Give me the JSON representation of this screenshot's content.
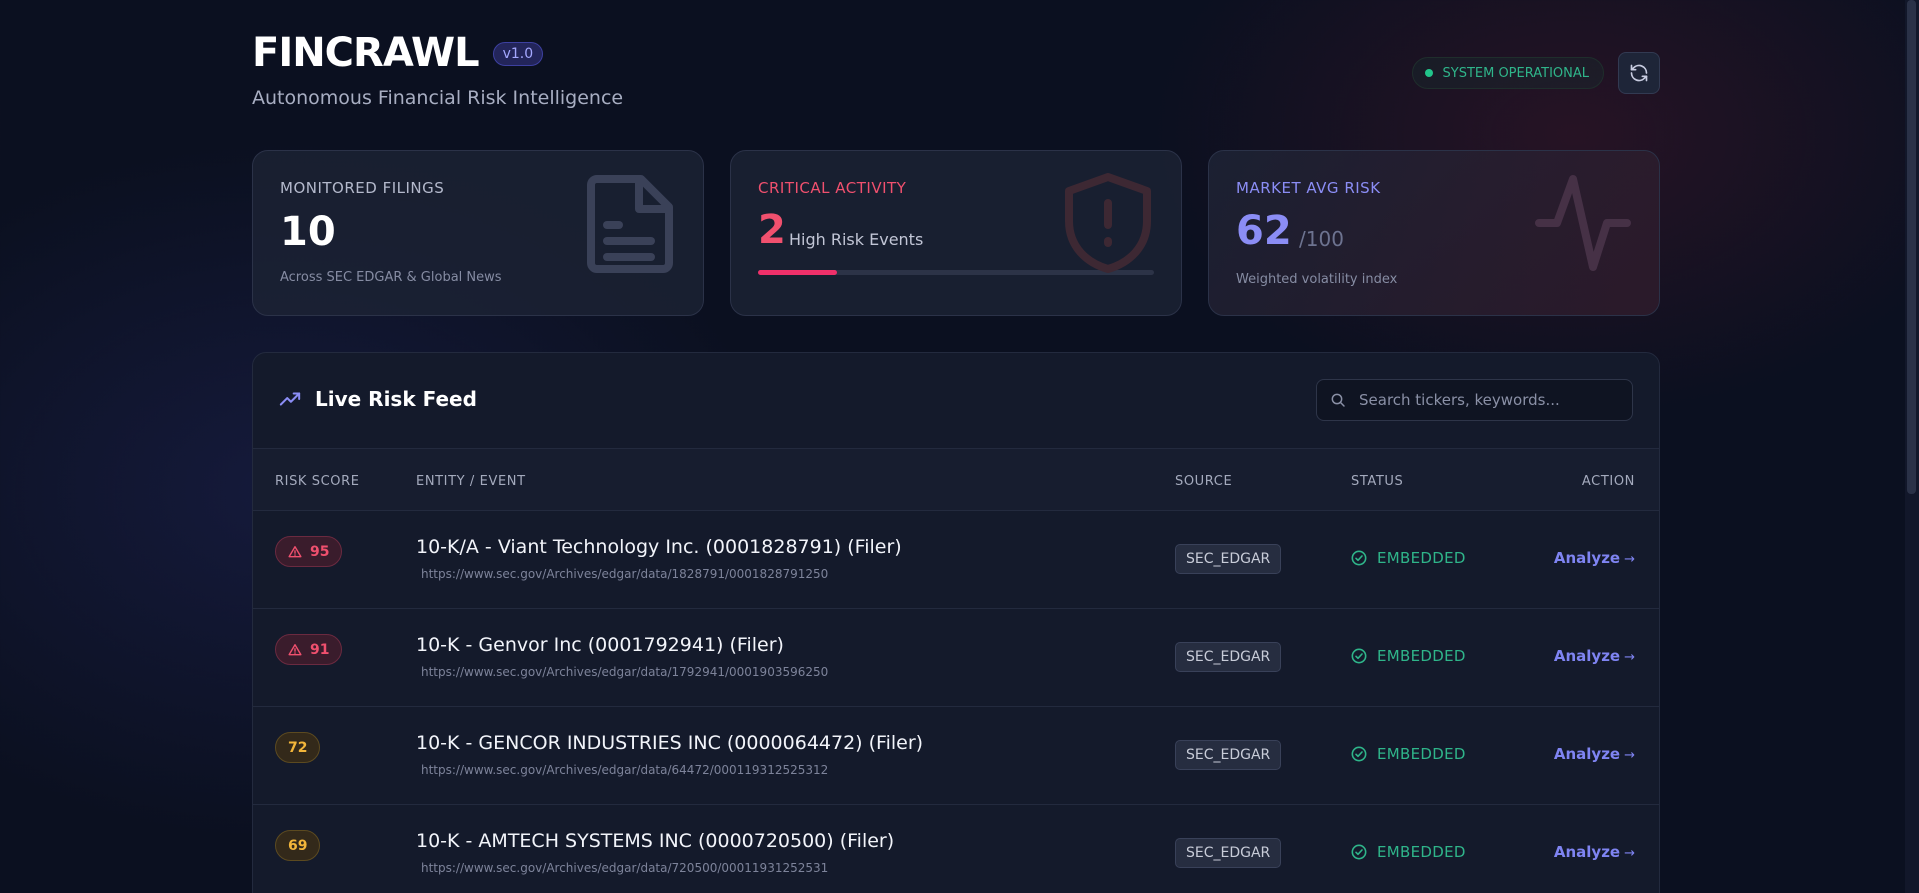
{
  "header": {
    "title": "FINCRAWL",
    "version": "v1.0",
    "subtitle": "Autonomous Financial Risk Intelligence",
    "status": "SYSTEM OPERATIONAL",
    "refresh_icon": "refresh-icon"
  },
  "stats": {
    "filings": {
      "label": "MONITORED FILINGS",
      "value": "10",
      "note": "Across SEC EDGAR & Global News",
      "icon": "document-icon"
    },
    "critical": {
      "label": "CRITICAL ACTIVITY",
      "value": "2",
      "suffix": "High Risk Events",
      "progress": 0.2,
      "icon": "shield-alert-icon"
    },
    "risk": {
      "label": "MARKET AVG RISK",
      "value": "62",
      "suffix": "/100",
      "note": "Weighted volatility index",
      "icon": "activity-icon"
    }
  },
  "feed": {
    "title": "Live Risk Feed",
    "icon": "trending-up-icon",
    "search_placeholder": "Search tickers, keywords...",
    "columns": {
      "score": "RISK SCORE",
      "entity": "ENTITY / EVENT",
      "source": "SOURCE",
      "status": "STATUS",
      "action": "ACTION"
    },
    "rows": [
      {
        "score": "95",
        "level": "high",
        "title": "10-K/A - Viant Technology Inc. (0001828791) (Filer)",
        "url": "https://www.sec.gov/Archives/edgar/data/1828791/0001828791250",
        "source": "SEC_EDGAR",
        "status": "EMBEDDED",
        "action": "Analyze",
        "arrow": "→"
      },
      {
        "score": "91",
        "level": "high",
        "title": "10-K - Genvor Inc (0001792941) (Filer)",
        "url": "https://www.sec.gov/Archives/edgar/data/1792941/0001903596250",
        "source": "SEC_EDGAR",
        "status": "EMBEDDED",
        "action": "Analyze",
        "arrow": "→"
      },
      {
        "score": "72",
        "level": "med",
        "title": "10-K - GENCOR INDUSTRIES INC (0000064472) (Filer)",
        "url": "https://www.sec.gov/Archives/edgar/data/64472/000119312525312",
        "source": "SEC_EDGAR",
        "status": "EMBEDDED",
        "action": "Analyze",
        "arrow": "→"
      },
      {
        "score": "69",
        "level": "med",
        "title": "10-K - AMTECH SYSTEMS INC (0000720500) (Filer)",
        "url": "https://www.sec.gov/Archives/edgar/data/720500/00011931252531",
        "source": "SEC_EDGAR",
        "status": "EMBEDDED",
        "action": "Analyze",
        "arrow": "→"
      }
    ]
  },
  "colors": {
    "accent": "#7f84f2",
    "critical": "#f0506e",
    "warning": "#f2b53a",
    "success": "#2fb58a",
    "background": "#0b1020"
  }
}
